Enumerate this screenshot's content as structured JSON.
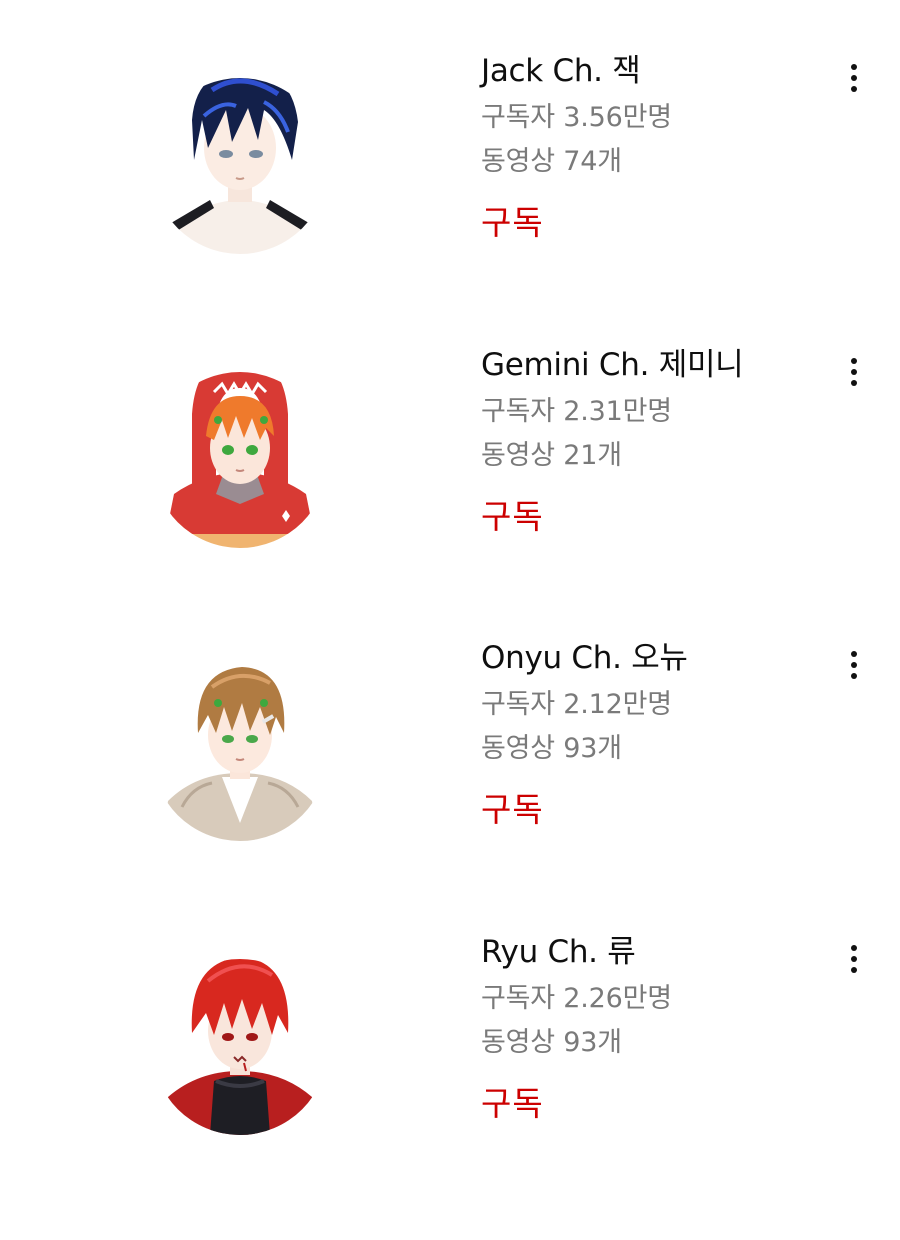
{
  "subscriptions": {
    "channels": [
      {
        "name": "Jack Ch. 잭",
        "subscribers": "구독자 3.56만명",
        "videos": "동영상 74개",
        "subscribe_label": "구독",
        "avatar_icon": "avatar-dark-blue-hair",
        "hair_color": "#13204a",
        "accent_color": "#2f4fd0"
      },
      {
        "name": "Gemini Ch. 제미니",
        "subscribers": "구독자 2.31만명",
        "videos": "동영상 21개",
        "subscribe_label": "구독",
        "avatar_icon": "avatar-orange-hair-red-hood",
        "hair_color": "#ef7a2c",
        "accent_color": "#d83a34"
      },
      {
        "name": "Onyu Ch. 오뉴",
        "subscribers": "구독자 2.12만명",
        "videos": "동영상 93개",
        "subscribe_label": "구독",
        "avatar_icon": "avatar-light-brown-hair",
        "hair_color": "#b07b42",
        "accent_color": "#d8cbbb"
      },
      {
        "name": "Ryu Ch. 류",
        "subscribers": "구독자 2.26만명",
        "videos": "동영상 93개",
        "subscribe_label": "구독",
        "avatar_icon": "avatar-red-hair",
        "hair_color": "#d8281f",
        "accent_color": "#b81f1f"
      }
    ],
    "colors": {
      "subscribe": "#cc0000",
      "meta_text": "#7a7a7a",
      "title_text": "#0f0f0f"
    }
  }
}
